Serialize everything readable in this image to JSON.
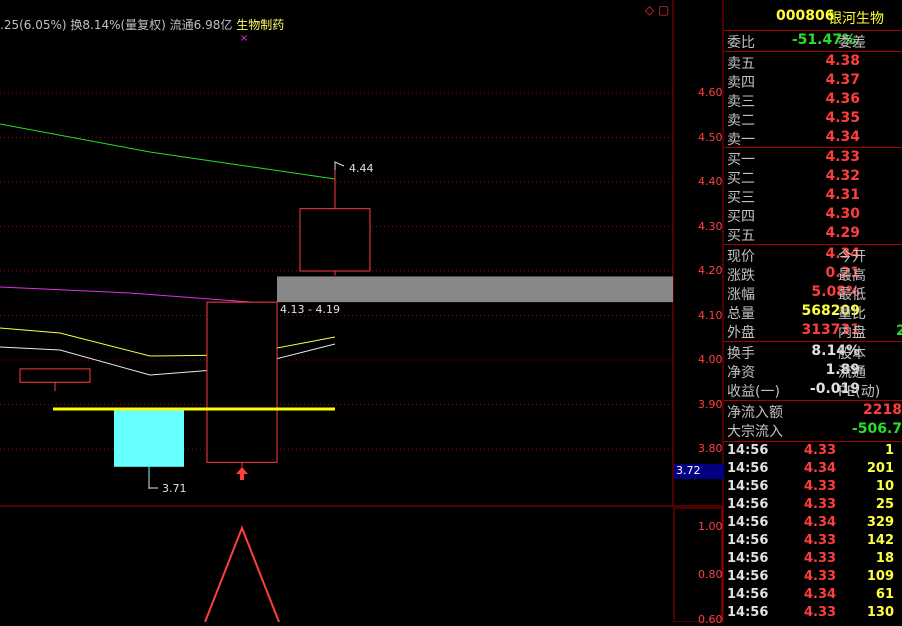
{
  "chart_info": {
    "prefix": ".25(6.05%) 换8.14%(量复权) 流通6.98亿",
    "industry": "生物制药"
  },
  "window_icons": "◇ ▢",
  "price_axis": [
    "4.60",
    "4.50",
    "4.40",
    "4.30",
    "4.20",
    "4.10",
    "4.00",
    "3.90",
    "3.80"
  ],
  "current_price_tag": "3.72",
  "sub_axis": [
    "1.00",
    "0.80",
    "0.60"
  ],
  "annotations": {
    "high_label": "4.44",
    "low_label": "3.71",
    "range_label": "4.13 - 4.19"
  },
  "panel": {
    "code": "000806",
    "name": "银河生物",
    "weibi_label": "委比",
    "weibi_value": "-51.47%",
    "weicha_label": "委差",
    "sell": [
      {
        "label": "卖五",
        "price": "4.38"
      },
      {
        "label": "卖四",
        "price": "4.37"
      },
      {
        "label": "卖三",
        "price": "4.36"
      },
      {
        "label": "卖二",
        "price": "4.35"
      },
      {
        "label": "卖一",
        "price": "4.34"
      }
    ],
    "buy": [
      {
        "label": "买一",
        "price": "4.33"
      },
      {
        "label": "买二",
        "price": "4.32"
      },
      {
        "label": "买三",
        "price": "4.31"
      },
      {
        "label": "买四",
        "price": "4.30"
      },
      {
        "label": "买五",
        "price": "4.29"
      }
    ],
    "quote": [
      {
        "label": "现价",
        "value": "4.34",
        "right": "今开"
      },
      {
        "label": "涨跌",
        "value": "0.21",
        "right": "最高"
      },
      {
        "label": "涨幅",
        "value": "5.08%",
        "right": "最低"
      },
      {
        "label": "总量",
        "value": "568209",
        "right": "量比"
      },
      {
        "label": "外盘",
        "value": "313731",
        "right": "内盘"
      }
    ],
    "inner_partial": "2",
    "stats": [
      {
        "label": "换手",
        "value": "8.14%",
        "right": "股本"
      },
      {
        "label": "净资",
        "value": "1.89",
        "right": "流通"
      },
      {
        "label": "收益(一)",
        "value": "-0.019",
        "right": "PE(动)"
      }
    ],
    "flows": [
      {
        "label": "净流入额",
        "value": "2218"
      },
      {
        "label": "大宗流入",
        "value": "-506.7"
      }
    ],
    "ticks": [
      {
        "time": "14:56",
        "price": "4.33",
        "vol": "1"
      },
      {
        "time": "14:56",
        "price": "4.34",
        "vol": "201"
      },
      {
        "time": "14:56",
        "price": "4.33",
        "vol": "10"
      },
      {
        "time": "14:56",
        "price": "4.33",
        "vol": "25"
      },
      {
        "time": "14:56",
        "price": "4.34",
        "vol": "329"
      },
      {
        "time": "14:56",
        "price": "4.33",
        "vol": "142"
      },
      {
        "time": "14:56",
        "price": "4.33",
        "vol": "18"
      },
      {
        "time": "14:56",
        "price": "4.33",
        "vol": "109"
      },
      {
        "time": "14:56",
        "price": "4.34",
        "vol": "61"
      },
      {
        "time": "14:56",
        "price": "4.33",
        "vol": "130"
      }
    ]
  },
  "colors": {
    "up": "#ff3d3d",
    "down_fill": "#66ffff",
    "ma_green": "#2bdc2b",
    "ma_magenta": "#e030e0",
    "ma_yellow": "#ffff40",
    "ma_white": "#e8e8e8",
    "support_line": "#ffff00",
    "zone_gray": "#888888",
    "grid_red": "#a00000"
  },
  "chart_data": {
    "type": "candlestick",
    "candles": [
      {
        "open": 3.95,
        "close": 3.98,
        "high": 3.98,
        "low": 3.93,
        "color": "up"
      },
      {
        "open": 3.89,
        "close": 3.76,
        "high": 3.89,
        "low": 3.71,
        "color": "down"
      },
      {
        "open": 3.77,
        "close": 4.13,
        "high": 4.13,
        "low": 3.76,
        "color": "up"
      },
      {
        "open": 4.2,
        "close": 4.34,
        "high": 4.44,
        "low": 4.19,
        "color": "up"
      }
    ],
    "support_level": 3.89,
    "gap_zone": [
      4.13,
      4.19
    ],
    "ylim": [
      3.72,
      4.68
    ],
    "sub_series": [
      0.6,
      1.0,
      0.6
    ]
  }
}
